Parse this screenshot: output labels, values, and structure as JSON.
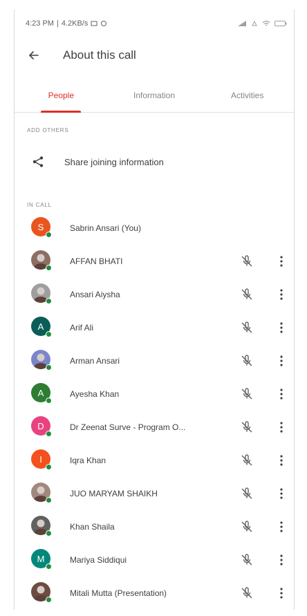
{
  "status_bar": {
    "time": "4:23 PM",
    "speed": "4.2KB/s",
    "battery": "⬛"
  },
  "header": {
    "title": "About this call"
  },
  "tabs": [
    {
      "label": "People",
      "active": true
    },
    {
      "label": "Information",
      "active": false
    },
    {
      "label": "Activities",
      "active": false
    }
  ],
  "add_others": {
    "section_label": "ADD OTHERS",
    "share_label": "Share joining information"
  },
  "in_call": {
    "section_label": "IN CALL",
    "participants": [
      {
        "name": "Sabrin Ansari (You)",
        "initial": "S",
        "color": "#e8561f",
        "photo": false,
        "controls": false
      },
      {
        "name": "AFFAN BHATI",
        "initial": "",
        "color": "#8d6e63",
        "photo": true,
        "controls": true
      },
      {
        "name": "Ansari Aiysha",
        "initial": "",
        "color": "#9e9e9e",
        "photo": true,
        "controls": true
      },
      {
        "name": "Arif Ali",
        "initial": "A",
        "color": "#0b5e57",
        "photo": false,
        "controls": true
      },
      {
        "name": "Arman Ansari",
        "initial": "",
        "color": "#7986cb",
        "photo": true,
        "controls": true
      },
      {
        "name": "Ayesha Khan",
        "initial": "A",
        "color": "#2e7d32",
        "photo": false,
        "controls": true
      },
      {
        "name": "Dr Zeenat Surve - Program O...",
        "initial": "D",
        "color": "#e8437f",
        "photo": false,
        "controls": true
      },
      {
        "name": "Iqra Khan",
        "initial": "I",
        "color": "#f4511e",
        "photo": false,
        "controls": true
      },
      {
        "name": "JUO MARYAM SHAIKH",
        "initial": "",
        "color": "#a1887f",
        "photo": true,
        "controls": true
      },
      {
        "name": "Khan Shaila",
        "initial": "",
        "color": "#616161",
        "photo": true,
        "controls": true
      },
      {
        "name": "Mariya Siddiqui",
        "initial": "M",
        "color": "#00897b",
        "photo": false,
        "controls": true
      },
      {
        "name": "Mitali Mutta (Presentation)",
        "initial": "",
        "color": "#6d4c41",
        "photo": true,
        "controls": true
      }
    ]
  },
  "colors": {
    "accent": "#d93025",
    "presence": "#1e8e3e",
    "muted_text": "#80868b"
  },
  "icons": {
    "back": "arrow-left-icon",
    "share": "share-icon",
    "mic": "mic-off-icon",
    "more": "more-vert-icon"
  }
}
